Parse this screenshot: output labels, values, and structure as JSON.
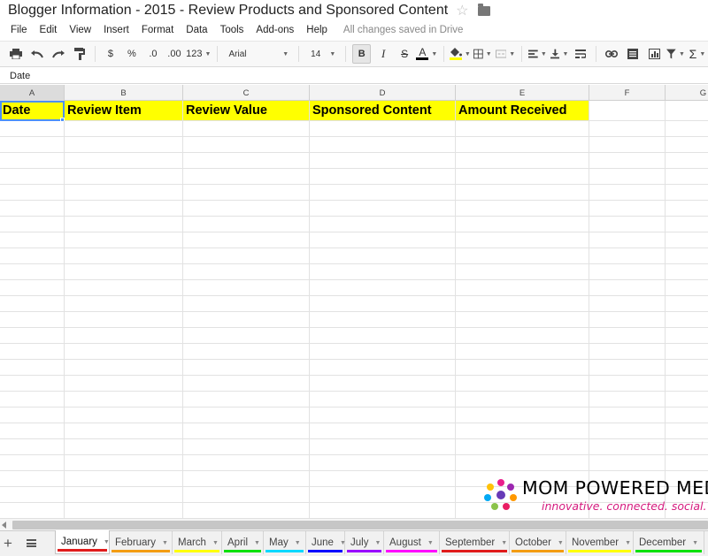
{
  "document": {
    "title": "Blogger Information - 2015 - Review Products and Sponsored Content",
    "save_status": "All changes saved in Drive"
  },
  "menu": [
    "File",
    "Edit",
    "View",
    "Insert",
    "Format",
    "Data",
    "Tools",
    "Add-ons",
    "Help"
  ],
  "toolbar": {
    "currency_label": "$",
    "percent_label": "%",
    "decrease_decimal_label": ".0",
    "increase_decimal_label": ".00",
    "more_formats_label": "123",
    "font": "Arial",
    "font_size": "14",
    "bold_label": "B",
    "italic_label": "I",
    "strike_label": "S",
    "text_color_label": "A",
    "sum_label": "Σ",
    "text_color": "#000000",
    "fill_color": "#ffff00"
  },
  "formula_bar": {
    "value": "Date"
  },
  "columns": [
    "A",
    "B",
    "C",
    "D",
    "E",
    "F",
    "G"
  ],
  "header_row": [
    "Date",
    "Review Item",
    "Review Value",
    "Sponsored Content",
    "Amount Received",
    "",
    ""
  ],
  "active_cell": "A1",
  "sheets": [
    {
      "name": "January",
      "color": "#e01b1b",
      "active": true
    },
    {
      "name": "February",
      "color": "#f39c12"
    },
    {
      "name": "March",
      "color": "#ffff00"
    },
    {
      "name": "April",
      "color": "#00e000"
    },
    {
      "name": "May",
      "color": "#00d8ff"
    },
    {
      "name": "June",
      "color": "#0000ff"
    },
    {
      "name": "July",
      "color": "#9900ff"
    },
    {
      "name": "August",
      "color": "#ff00ff"
    },
    {
      "name": "September",
      "color": "#e01b1b"
    },
    {
      "name": "October",
      "color": "#f39c12"
    },
    {
      "name": "November",
      "color": "#ffff00"
    },
    {
      "name": "December",
      "color": "#00e000"
    }
  ],
  "watermark": {
    "name": "MOM POWERED MEDIA",
    "tagline": "innovative. connected. social."
  }
}
